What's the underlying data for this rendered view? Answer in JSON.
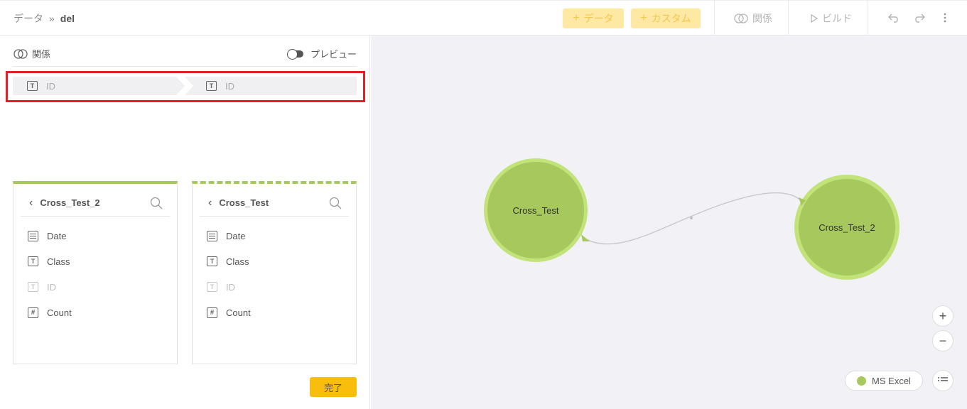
{
  "header": {
    "breadcrumb_root": "データ",
    "breadcrumb_sep": "»",
    "breadcrumb_current": "del",
    "add_data_label": "データ",
    "add_custom_label": "カスタム",
    "relation_label": "関係",
    "build_label": "ビルド",
    "undo_icon": "undo-icon",
    "redo_icon": "redo-icon",
    "more_icon": "more-vertical-icon"
  },
  "panel": {
    "relation_title": "関係",
    "preview_label": "プレビュー",
    "join": {
      "left_field": "ID",
      "right_field": "ID"
    },
    "tables": [
      {
        "name": "Cross_Test_2",
        "fields": [
          {
            "name": "Date",
            "type": "date",
            "dim": false
          },
          {
            "name": "Class",
            "type": "text",
            "dim": false
          },
          {
            "name": "ID",
            "type": "text",
            "dim": true
          },
          {
            "name": "Count",
            "type": "number",
            "dim": false
          }
        ]
      },
      {
        "name": "Cross_Test",
        "fields": [
          {
            "name": "Date",
            "type": "date",
            "dim": false
          },
          {
            "name": "Class",
            "type": "text",
            "dim": false
          },
          {
            "name": "ID",
            "type": "text",
            "dim": true
          },
          {
            "name": "Count",
            "type": "number",
            "dim": false
          }
        ]
      }
    ],
    "done_label": "完了"
  },
  "canvas": {
    "nodes": [
      {
        "label": "Cross_Test"
      },
      {
        "label": "Cross_Test_2"
      }
    ],
    "zoom_in": "+",
    "zoom_out": "−",
    "legend_label": "MS Excel",
    "legend_color": "#a6c85c",
    "list_icon": "list-icon"
  },
  "colors": {
    "accent_yellow": "#f9bd0c",
    "node_green": "#a6c85c",
    "node_ring": "#c2e27a",
    "highlight_red": "#e01f26"
  }
}
